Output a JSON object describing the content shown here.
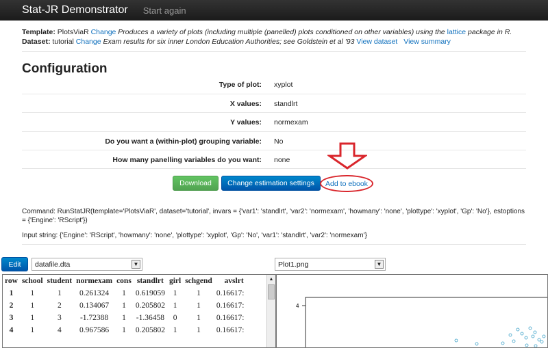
{
  "navbar": {
    "brand": "Stat-JR Demonstrator",
    "start_again": "Start again"
  },
  "template": {
    "label": "Template",
    "name": "PlotsViaR",
    "change": "Change",
    "description_pre": "Produces a variety of plots (including multiple (panelled) plots conditioned on other variables) using the",
    "lattice": "lattice",
    "description_post": "package in R."
  },
  "dataset": {
    "label": "Dataset",
    "name": "tutorial",
    "change": "Change",
    "description": "Exam results for six inner London Education Authorities; see Goldstein et al '93",
    "view_dataset": "View dataset",
    "view_summary": "View summary"
  },
  "configuration": {
    "title": "Configuration",
    "rows": [
      {
        "label": "Type of plot:",
        "value": "xyplot"
      },
      {
        "label": "X values:",
        "value": "standlrt"
      },
      {
        "label": "Y values:",
        "value": "normexam"
      },
      {
        "label": "Do you want a (within-plot) grouping variable:",
        "value": "No"
      },
      {
        "label": "How many panelling variables do you want:",
        "value": "none"
      }
    ]
  },
  "buttons": {
    "download": "Download",
    "change_settings": "Change estimation settings",
    "add_to_ebook": "Add to ebook"
  },
  "command": "Command: RunStatJR(template='PlotsViaR', dataset='tutorial', invars = {'var1': 'standlrt', 'var2': 'normexam', 'howmany': 'none', 'plottype': 'xyplot', 'Gp': 'No'}, estoptions = {'Engine': 'RScript'})",
  "input_string": "Input string: {'Engine': 'RScript', 'howmany': 'none', 'plottype': 'xyplot', 'Gp': 'No', 'var1': 'standlrt', 'var2': 'normexam'}",
  "edit_button": "Edit",
  "file_select": "datafile.dta",
  "plot_select": "Plot1.png",
  "table": {
    "headers": [
      "row",
      "school",
      "student",
      "normexam",
      "cons",
      "standlrt",
      "girl",
      "schgend",
      "avslrt"
    ],
    "rows": [
      [
        "1",
        "1",
        "1",
        "0.261324",
        "1",
        "0.619059",
        "1",
        "1",
        "0.16617:"
      ],
      [
        "2",
        "1",
        "2",
        "0.134067",
        "1",
        "0.205802",
        "1",
        "1",
        "0.16617:"
      ],
      [
        "3",
        "1",
        "3",
        "-1.72388",
        "1",
        "-1.36458",
        "0",
        "1",
        "0.16617:"
      ],
      [
        "4",
        "1",
        "4",
        "0.967586",
        "1",
        "0.205802",
        "1",
        "1",
        "0.16617:"
      ]
    ]
  },
  "plot": {
    "y_tick": "4"
  },
  "colors": {
    "navbar": "#222222",
    "green": "#5bb75b",
    "blue": "#0074cc",
    "annotation_red": "#d9262c",
    "points": "#3aa0c8"
  }
}
